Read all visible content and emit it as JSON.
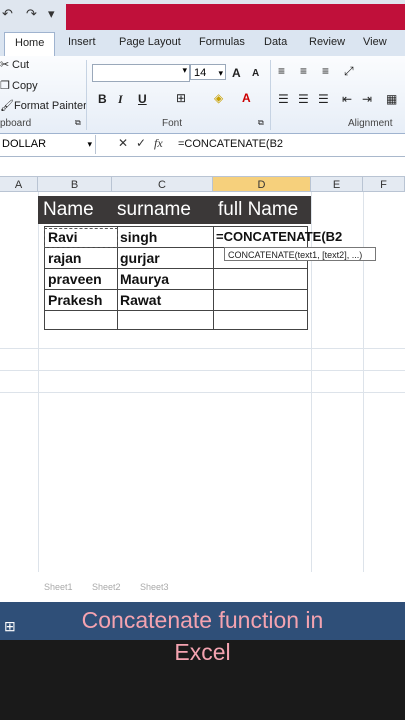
{
  "qat": {
    "undo": "↶",
    "redo": "↷",
    "more": "▾"
  },
  "tabs": [
    "Home",
    "Insert",
    "Page Layout",
    "Formulas",
    "Data",
    "Review",
    "View"
  ],
  "clipboard": {
    "cut": "Cut",
    "copy": "Copy",
    "format_painter": "Format Painter",
    "group": "pboard"
  },
  "font": {
    "size": "14",
    "group": "Font",
    "grow": "A",
    "shrink": "A",
    "bold": "B",
    "italic": "I",
    "underline": "U"
  },
  "alignment": {
    "group": "Alignment"
  },
  "formula_bar": {
    "name_box": "DOLLAR",
    "cancel": "✕",
    "enter": "✓",
    "fx": "fx",
    "formula": "=CONCATENATE(B2"
  },
  "columns": [
    "A",
    "B",
    "C",
    "D",
    "E",
    "F"
  ],
  "table": {
    "headers": [
      "Name",
      "surname",
      "full Name"
    ],
    "rows": [
      [
        "Ravi",
        "singh",
        "=CONCATENATE(B2"
      ],
      [
        "rajan",
        "gurjar",
        ""
      ],
      [
        "praveen",
        "Maurya",
        ""
      ],
      [
        "Prakesh",
        "Rawat",
        ""
      ]
    ]
  },
  "tooltip": "CONCATENATE(text1, [text2], ...)",
  "sheets": [
    "Sheet1",
    "Sheet2",
    "Sheet3"
  ],
  "caption": {
    "line1": "Concatenate function in",
    "line2": "Excel"
  }
}
